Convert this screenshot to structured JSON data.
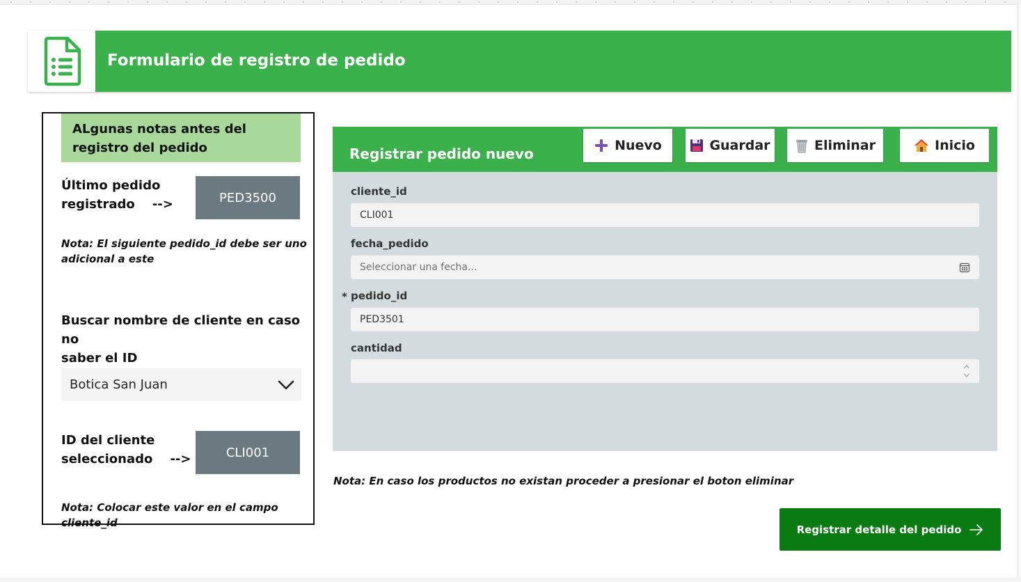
{
  "header": {
    "title": "Formulario de registro de pedido",
    "icon": "document-list-icon"
  },
  "left_panel": {
    "notes_title": "ALgunas notas antes del registro del pedido",
    "last_order_label_line1": "Último pedido",
    "last_order_label_line2": "registrado    -->",
    "last_order_value": "PED3500",
    "note1_line1": "Nota: El siguiente pedido_id debe ser uno",
    "note1_line2": "adicional a este",
    "search_label_line1": "Buscar nombre de cliente en caso no",
    "search_label_line2": "saber el ID",
    "client_dropdown_value": "Botica San Juan",
    "client_id_label_line1": "ID del cliente",
    "client_id_label_line2": "seleccionado    -->",
    "client_id_value": "CLI001",
    "note2": "Nota: Colocar este valor en el campo cliente_id"
  },
  "form": {
    "title": "Registrar pedido nuevo",
    "buttons": {
      "new_label": "Nuevo",
      "save_label": "Guardar",
      "delete_label": "Eliminar",
      "home_label": "Inicio"
    },
    "fields": {
      "cliente_id_label": "cliente_id",
      "cliente_id_value": "CLI001",
      "fecha_pedido_label": "fecha_pedido",
      "fecha_pedido_placeholder": "Seleccionar una fecha...",
      "pedido_id_required_mark": "*",
      "pedido_id_label": "pedido_id",
      "pedido_id_value": "PED3501",
      "cantidad_label": "cantidad",
      "cantidad_value": ""
    }
  },
  "bottom_note": "Nota: En caso los productos no existan proceder a presionar el boton eliminar",
  "cta_label": "Registrar detalle del pedido",
  "colors": {
    "brand_green": "#3ab14a",
    "cta_green": "#0a7a12",
    "notes_header": "#a8d89a",
    "value_box": "#6b7a80",
    "form_bg": "#d5dcdf"
  }
}
